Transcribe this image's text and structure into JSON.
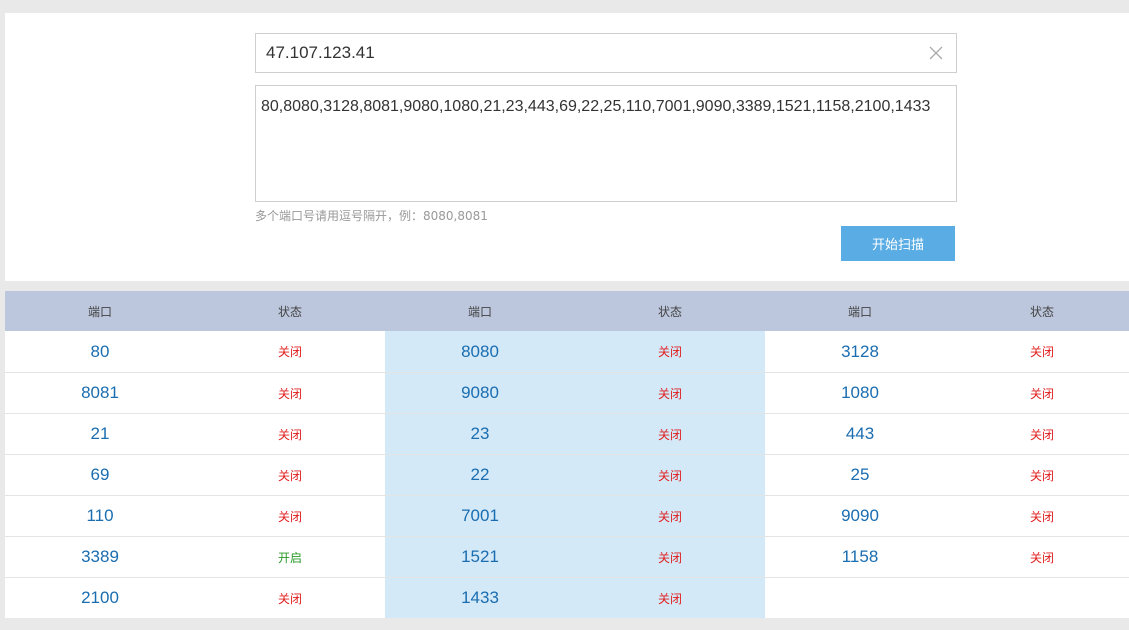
{
  "scanner": {
    "ip_value": "47.107.123.41",
    "ports_value": "80,8080,3128,8081,9080,1080,21,23,443,69,22,25,110,7001,9090,3389,1521,1158,2100,1433",
    "hint": "多个端口号请用逗号隔开，例：8080,8081",
    "scan_label": "开始扫描"
  },
  "results": {
    "headers": [
      "端口",
      "状态",
      "端口",
      "状态",
      "端口",
      "状态"
    ],
    "rows": [
      [
        {
          "port": "80",
          "status": "关闭"
        },
        {
          "port": "8080",
          "status": "关闭"
        },
        {
          "port": "3128",
          "status": "关闭"
        }
      ],
      [
        {
          "port": "8081",
          "status": "关闭"
        },
        {
          "port": "9080",
          "status": "关闭"
        },
        {
          "port": "1080",
          "status": "关闭"
        }
      ],
      [
        {
          "port": "21",
          "status": "关闭"
        },
        {
          "port": "23",
          "status": "关闭"
        },
        {
          "port": "443",
          "status": "关闭"
        }
      ],
      [
        {
          "port": "69",
          "status": "关闭"
        },
        {
          "port": "22",
          "status": "关闭"
        },
        {
          "port": "25",
          "status": "关闭"
        }
      ],
      [
        {
          "port": "110",
          "status": "关闭"
        },
        {
          "port": "7001",
          "status": "关闭"
        },
        {
          "port": "9090",
          "status": "关闭"
        }
      ],
      [
        {
          "port": "3389",
          "status": "开启"
        },
        {
          "port": "1521",
          "status": "关闭"
        },
        {
          "port": "1158",
          "status": "关闭"
        }
      ],
      [
        {
          "port": "2100",
          "status": "关闭"
        },
        {
          "port": "1433",
          "status": "关闭"
        },
        null
      ]
    ]
  },
  "colors": {
    "open": "#2a9a2a",
    "closed": "#e02020",
    "accent": "#5aade4",
    "header_bg": "#bcc6dc",
    "highlight_col": "#d3e9f8"
  },
  "icons": {
    "clear": "close-icon"
  }
}
